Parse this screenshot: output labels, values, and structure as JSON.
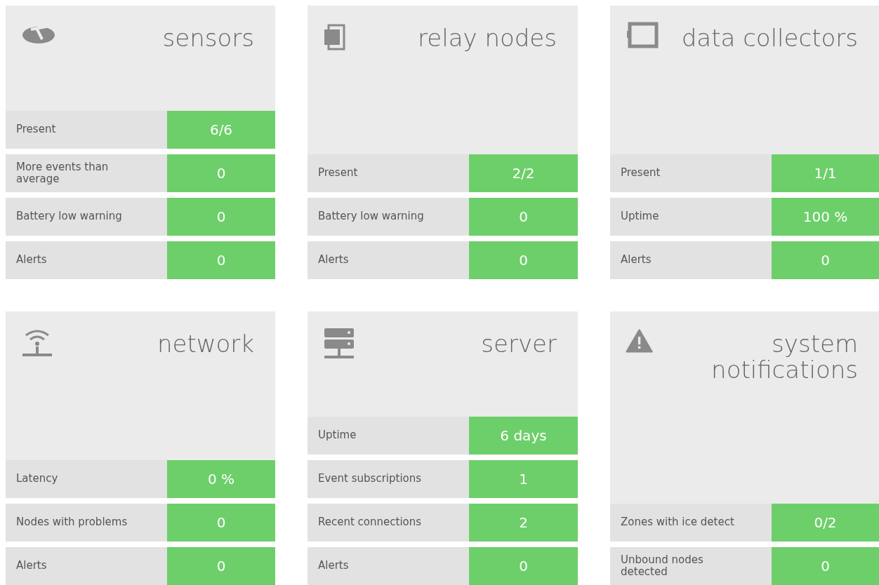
{
  "panels": [
    {
      "title": "sensors",
      "kind": "sensor",
      "stats": [
        {
          "label": "Present",
          "value": "6/6"
        },
        {
          "label": "More events than average",
          "value": "0"
        },
        {
          "label": "Battery low warning",
          "value": "0"
        },
        {
          "label": "Alerts",
          "value": "0"
        }
      ]
    },
    {
      "title": "relay nodes",
      "kind": "relay",
      "stats": [
        {
          "label": "Present",
          "value": "2/2"
        },
        {
          "label": "Battery low warning",
          "value": "0"
        },
        {
          "label": "Alerts",
          "value": "0"
        }
      ]
    },
    {
      "title": "data collectors",
      "kind": "collector",
      "stats": [
        {
          "label": "Present",
          "value": "1/1"
        },
        {
          "label": "Uptime",
          "value": "100 %"
        },
        {
          "label": "Alerts",
          "value": "0"
        }
      ]
    },
    {
      "title": "network",
      "kind": "network",
      "stats": [
        {
          "label": "Latency",
          "value": "0 %"
        },
        {
          "label": "Nodes with problems",
          "value": "0"
        },
        {
          "label": "Alerts",
          "value": "0"
        }
      ]
    },
    {
      "title": "server",
      "kind": "server",
      "stats": [
        {
          "label": "Uptime",
          "value": "6 days"
        },
        {
          "label": "Event subscriptions",
          "value": "1"
        },
        {
          "label": "Recent connections",
          "value": "2"
        },
        {
          "label": "Alerts",
          "value": "0"
        }
      ]
    },
    {
      "title": "system notifications",
      "kind": "notification",
      "stats": [
        {
          "label": "Zones with ice detect",
          "value": "0/2"
        },
        {
          "label": "Unbound nodes detected",
          "value": "0"
        }
      ]
    }
  ]
}
